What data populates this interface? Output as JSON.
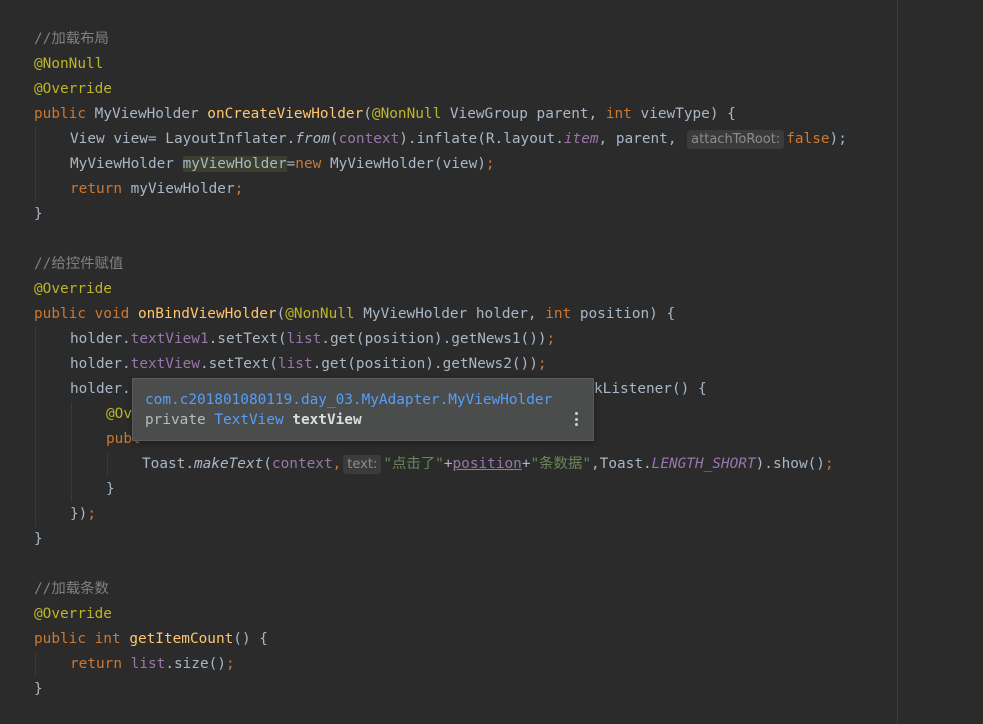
{
  "editor": {
    "lines": {
      "c1": "//加载布局",
      "a1": "@NonNull",
      "a2": "@Override",
      "l4_kw": "public ",
      "l4_type": "MyViewHolder ",
      "l4_fn": "onCreateViewHolder",
      "l4_p1": "(",
      "l4_ann": "@NonNull",
      "l4_p2": " ViewGroup parent, ",
      "l4_kw2": "int",
      "l4_p3": " viewType) {",
      "l5_a": "View view= LayoutInflater.",
      "l5_st": "from",
      "l5_b": "(",
      "l5_ctx": "context",
      "l5_c": ").inflate(R.layout.",
      "l5_item": "item",
      "l5_d": ", parent, ",
      "l5_hint": "attachToRoot:",
      "l5_false": "false",
      "l5_end": ");",
      "l6_a": "MyViewHolder ",
      "l6_var": "myViewHolder",
      "l6_b": "=",
      "l6_new": "new",
      "l6_c": " MyViewHolder(view)",
      "l6_semi": ";",
      "l7_ret": "return",
      "l7_a": " myViewHolder",
      "l7_semi": ";",
      "l8": "}",
      "c2": "//给控件赋值",
      "a3": "@Override",
      "l11_kw": "public void ",
      "l11_fn": "onBindViewHolder",
      "l11_p1": "(",
      "l11_ann": "@NonNull",
      "l11_p2": " MyViewHolder holder, ",
      "l11_kw2": "int",
      "l11_p3": " position) {",
      "l12_a": "holder.",
      "l12_f": "textView1",
      "l12_b": ".setText(",
      "l12_l": "list",
      "l12_c": ".get(position).getNews1())",
      "l12_semi": ";",
      "l13_a": "holder.",
      "l13_f": "textView",
      "l13_b": ".setText(",
      "l13_l": "list",
      "l13_c": ".get(position).getNews2())",
      "l13_semi": ";",
      "l14_a": "holder.",
      "l14_tail": "kListener() {",
      "l15_ann": "@Ov",
      "l16_a": "publ",
      "l17_a": "Toast.",
      "l17_st": "makeText",
      "l17_b": "(",
      "l17_ctx": "context",
      "l17_comma": ",",
      "l17_hint": "text:",
      "l17_s1": "\"点击了\"",
      "l17_plus1": "+",
      "l17_pos": "position",
      "l17_plus2": "+",
      "l17_s2": "\"条数据\"",
      "l17_c": ",Toast.",
      "l17_const": "LENGTH_SHORT",
      "l17_d": ").show()",
      "l17_semi": ";",
      "l18": "}",
      "l19_a": "})",
      "l19_semi": ";",
      "l20": "}",
      "c3": "//加载条数",
      "a4": "@Override",
      "l24_kw": "public int ",
      "l24_fn": "getItemCount",
      "l24_p": "() {",
      "l25_ret": "return ",
      "l25_l": "list",
      "l25_a": ".size()",
      "l25_semi": ";",
      "l26": "}"
    }
  },
  "popup": {
    "fqn": "com.c201801080119.day_03.MyAdapter.MyViewHolder",
    "modifier": "private ",
    "type": "TextView",
    "name": "textView",
    "more_icon": "more-vertical-icon"
  },
  "colors": {
    "background": "#2b2b2b",
    "keyword": "#cc7832",
    "annotation": "#bbb529",
    "comment": "#808080",
    "method": "#ffc66d",
    "field": "#9876aa",
    "string": "#6a8759",
    "text": "#a9b7c6"
  }
}
